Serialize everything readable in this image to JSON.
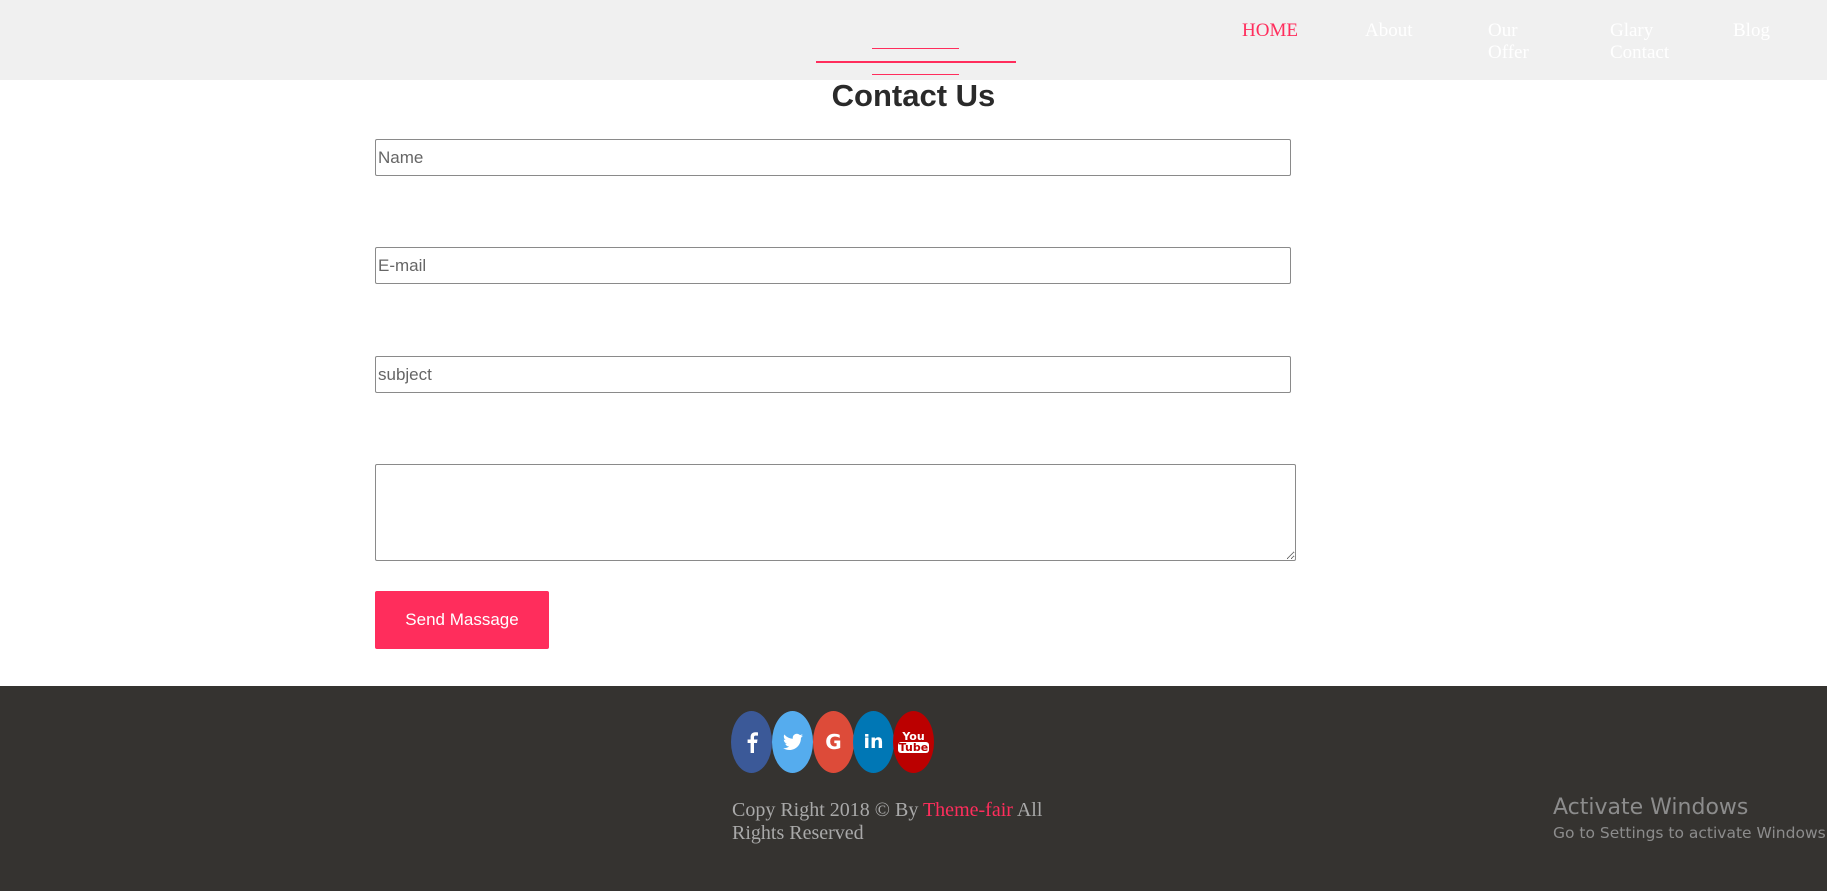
{
  "nav": {
    "home": "HOME",
    "about": "About",
    "offer": "Our Offer",
    "glary": "Glary Contact",
    "blog": "Blog"
  },
  "contact": {
    "title": "Contact Us",
    "name_placeholder": "Name",
    "email_placeholder": "E-mail",
    "subject_placeholder": "subject",
    "message_placeholder": "",
    "send_label": "Send Massage"
  },
  "footer": {
    "social": [
      {
        "icon": "facebook-icon",
        "glyph": "f",
        "color": "#3b5998"
      },
      {
        "icon": "twitter-icon",
        "glyph": "🐦",
        "color": "#55acee"
      },
      {
        "icon": "google-plus-icon",
        "glyph": "G",
        "color": "#dd4b39"
      },
      {
        "icon": "linkedin-icon",
        "glyph": "in",
        "color": "#0077b5"
      },
      {
        "icon": "youtube-icon",
        "glyph": "You Tube",
        "color": "#bb0000"
      }
    ],
    "copyright_prefix": "Copy Right 2018 © By ",
    "copyright_brand": "Theme-fair",
    "copyright_suffix": " All Rights Reserved"
  },
  "watermark": {
    "title": "Activate Windows",
    "subtitle": "Go to Settings to activate Windows."
  },
  "colors": {
    "accent": "#ff2d5c",
    "header_bg": "#f0f0f0",
    "footer_bg": "#353330"
  }
}
